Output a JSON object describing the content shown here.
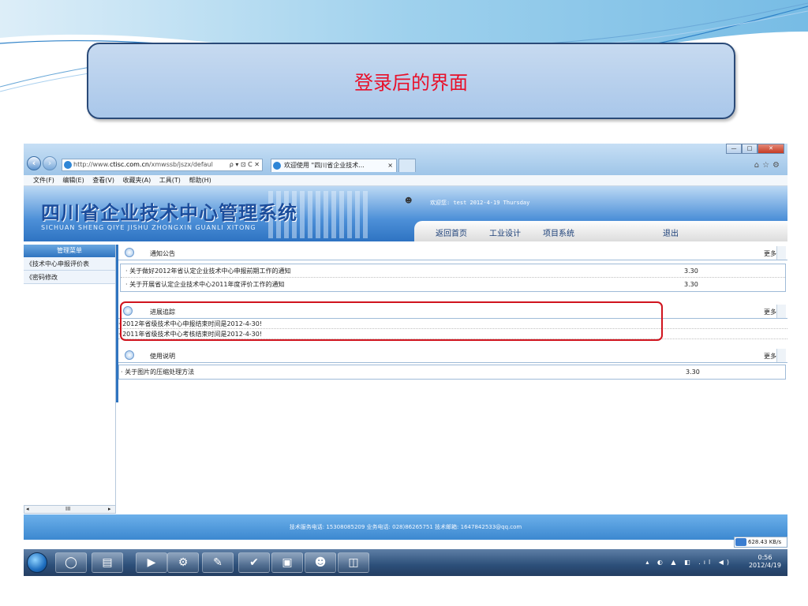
{
  "slide": {
    "title": "登录后的界面"
  },
  "browser": {
    "address_prefix": "http://www.",
    "address_domain": "ctisc.com.cn",
    "address_path": "/xmwssb/jszx/defaul",
    "address_controls": "ρ ▾ ⊡ C ✕",
    "tab_title": "欢迎使用 \"四川省企业技术...",
    "tab_close": "×",
    "menu": [
      "文件(F)",
      "编辑(E)",
      "查看(V)",
      "收藏夹(A)",
      "工具(T)",
      "帮助(H)"
    ],
    "window_buttons": [
      "—",
      "□",
      "✕"
    ],
    "right_icons": "⌂☆⚙"
  },
  "site": {
    "logo_cn": "四川省企业技术中心管理系统",
    "logo_en": "SICHUAN SHENG QIYE JISHU ZHONGXIN GUANLI XITONG",
    "welcome": "欢迎您: test 2012-4-19 Thursday",
    "nav": [
      "返回首页",
      "工业设计",
      "项目系统",
      "退出"
    ]
  },
  "sidebar": {
    "header": "管理菜单",
    "items": [
      "《技术中心申报评价表",
      "《密码修改"
    ],
    "scroll_left": "◂",
    "scroll_mid": "III",
    "scroll_right": "▸"
  },
  "sections": [
    {
      "title": "通知公告",
      "more": "更多",
      "rows": [
        {
          "text": "· 关于做好2012年省认定企业技术中心申报前期工作的通知",
          "date": "3.30"
        },
        {
          "text": "· 关于开展省认定企业技术中心2011年度评价工作的通知",
          "date": "3.30"
        }
      ]
    },
    {
      "title": "进展追踪",
      "more": "更多",
      "rows": [
        {
          "text": "· 2012年省级技术中心申报结束时间是2012-4-30!"
        },
        {
          "text": "· 2011年省级技术中心考核结束时间是2012-4-30!"
        }
      ]
    },
    {
      "title": "使用说明",
      "more": "更多",
      "rows": [
        {
          "text": "· 关于图片的压缩处理方法",
          "date": "3.30"
        }
      ]
    }
  ],
  "footer": "技术服务电话: 15308085209 业务电话: 028)86265751 技术邮箱: 1647842533@qq.com",
  "status": {
    "speed": "628.43 KB/s"
  },
  "taskbar": {
    "time": "0:56",
    "date": "2012/4/19",
    "tray_icons": "▴ ◐ ▲ ◧ .ıl ◀)"
  }
}
